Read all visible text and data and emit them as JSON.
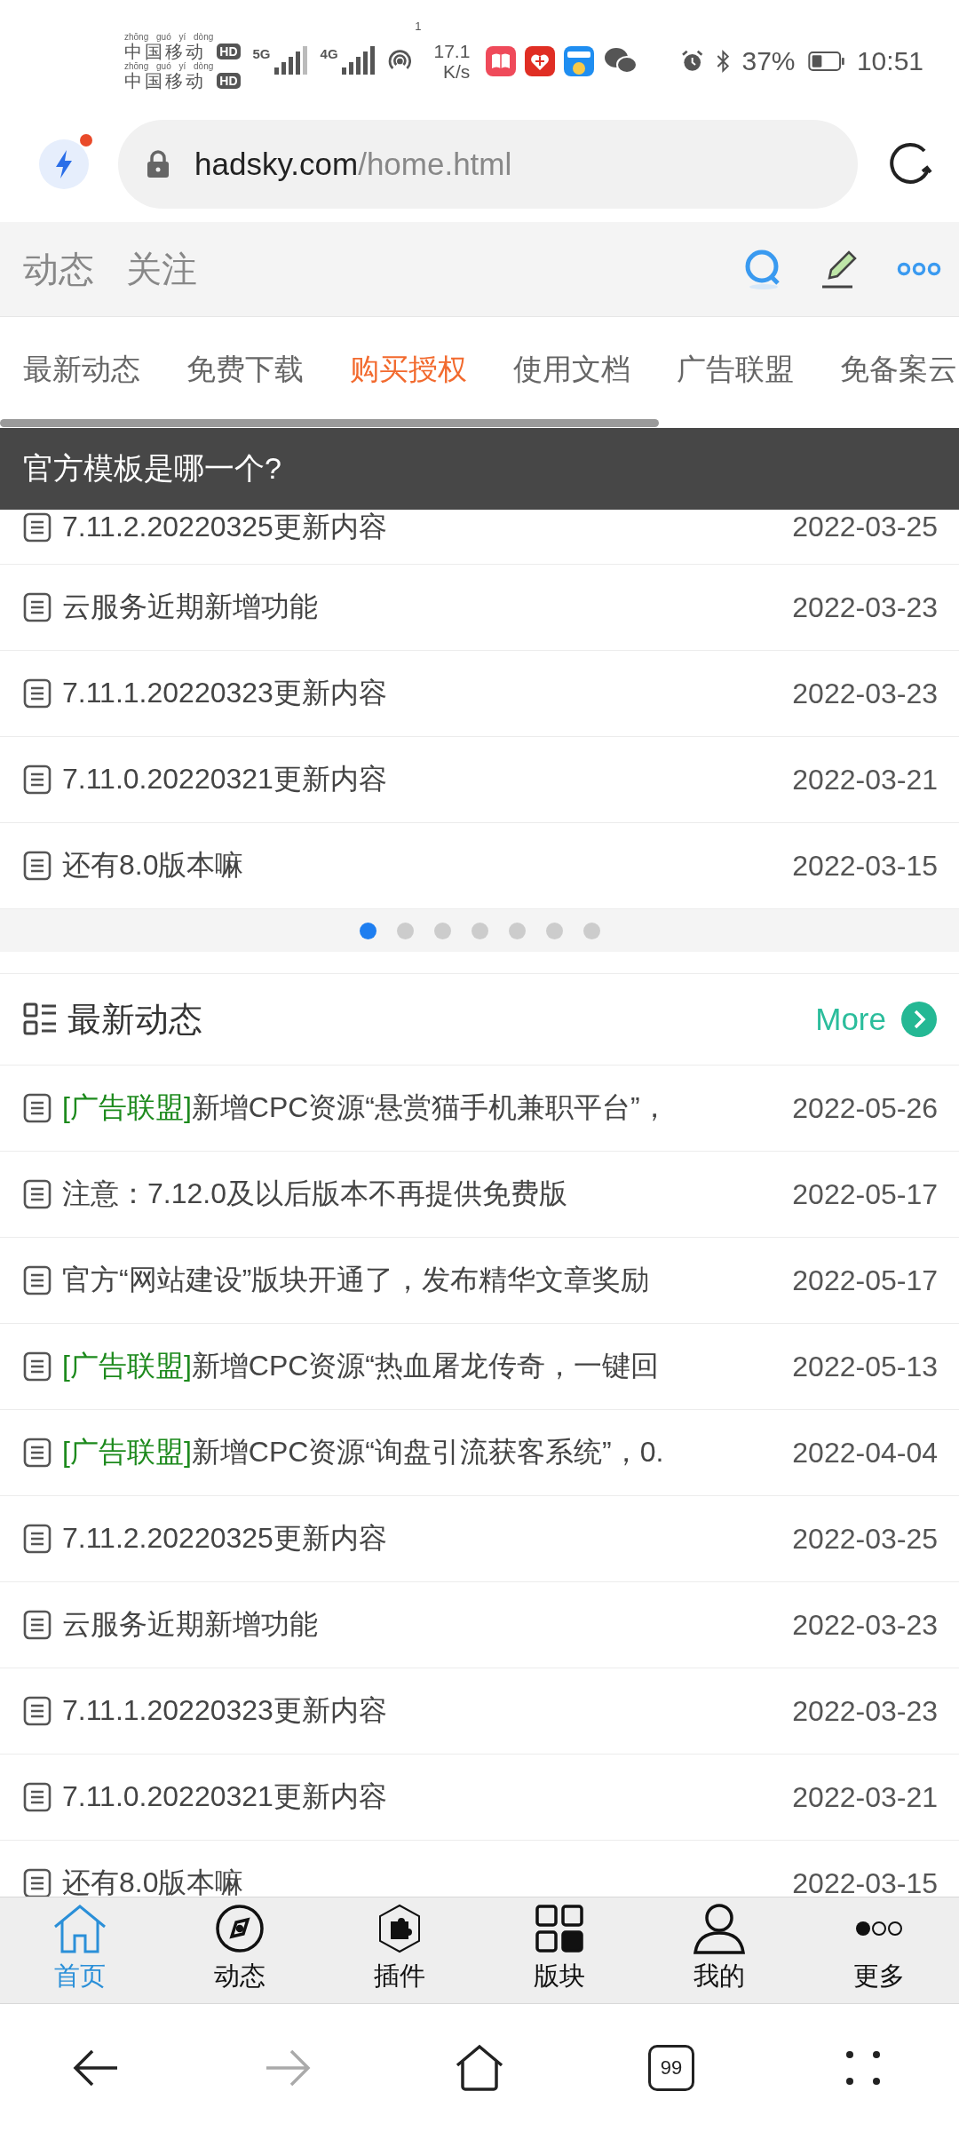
{
  "status_bar": {
    "carriers": [
      {
        "pinyin": "zhōng guó yí dòng",
        "name": "中国移动",
        "badge": "HD"
      },
      {
        "pinyin": "zhōng guó yí dòng",
        "name": "中国移动",
        "badge": "HD"
      }
    ],
    "networks": [
      "5G",
      "4G"
    ],
    "hotspot_count": "1",
    "speed": "17.1",
    "speed_unit": "K/s",
    "battery": "37%",
    "time": "10:51"
  },
  "address_bar": {
    "domain": "hadsky.com",
    "path": "/home.html"
  },
  "header": {
    "links": [
      "动态",
      "关注"
    ]
  },
  "categories": [
    {
      "label": "最新动态",
      "selected": false
    },
    {
      "label": "免费下载",
      "selected": false
    },
    {
      "label": "购买授权",
      "selected": true
    },
    {
      "label": "使用文档",
      "selected": false
    },
    {
      "label": "广告联盟",
      "selected": false
    },
    {
      "label": "免备案云",
      "selected": false
    }
  ],
  "carousel": {
    "caption": "官方模板是哪一个?",
    "posts": [
      {
        "title": "7.11.2.20220325更新内容",
        "date": "2022-03-25"
      },
      {
        "title": "云服务近期新增功能",
        "date": "2022-03-23"
      },
      {
        "title": "7.11.1.20220323更新内容",
        "date": "2022-03-23"
      },
      {
        "title": "7.11.0.20220321更新内容",
        "date": "2022-03-21"
      },
      {
        "title": "还有8.0版本嘛",
        "date": "2022-03-15"
      }
    ],
    "dots": [
      {
        "selected": true
      },
      {
        "selected": false
      },
      {
        "selected": false
      },
      {
        "selected": false
      },
      {
        "selected": false
      },
      {
        "selected": false
      },
      {
        "selected": false
      }
    ]
  },
  "latest_section": {
    "title": "最新动态",
    "more": "More",
    "posts": [
      {
        "tag": "[广告联盟]",
        "title": "新增CPC资源“悬赏猫手机兼职平台”，",
        "date": "2022-05-26"
      },
      {
        "title": "注意：7.12.0及以后版本不再提供免费版",
        "date": "2022-05-17"
      },
      {
        "title": "官方“网站建设”版块开通了，发布精华文章奖励",
        "date": "2022-05-17"
      },
      {
        "tag": "[广告联盟]",
        "title": "新增CPC资源“热血屠龙传奇，一键回",
        "date": "2022-05-13"
      },
      {
        "tag": "[广告联盟]",
        "title": "新增CPC资源“询盘引流获客系统”，0.",
        "date": "2022-04-04"
      },
      {
        "title": "7.11.2.20220325更新内容",
        "date": "2022-03-25"
      },
      {
        "title": "云服务近期新增功能",
        "date": "2022-03-23"
      },
      {
        "title": "7.11.1.20220323更新内容",
        "date": "2022-03-23"
      },
      {
        "title": "7.11.0.20220321更新内容",
        "date": "2022-03-21"
      },
      {
        "title": "还有8.0版本嘛",
        "date": "2022-03-15"
      }
    ]
  },
  "bottom_nav": [
    {
      "label": "首页",
      "kind": "home",
      "selected": true
    },
    {
      "label": "动态",
      "kind": "compass",
      "selected": false
    },
    {
      "label": "插件",
      "kind": "plugin",
      "selected": false
    },
    {
      "label": "版块",
      "kind": "grid",
      "selected": false
    },
    {
      "label": "我的",
      "kind": "user",
      "selected": false
    },
    {
      "label": "更多",
      "kind": "more",
      "selected": false
    }
  ],
  "browser_toolbar": [
    {
      "kind": "back",
      "disabled": false
    },
    {
      "kind": "forward",
      "disabled": true
    },
    {
      "kind": "home",
      "disabled": false
    },
    {
      "kind": "tabs",
      "count": "99",
      "disabled": false
    },
    {
      "kind": "menu",
      "disabled": false
    }
  ]
}
